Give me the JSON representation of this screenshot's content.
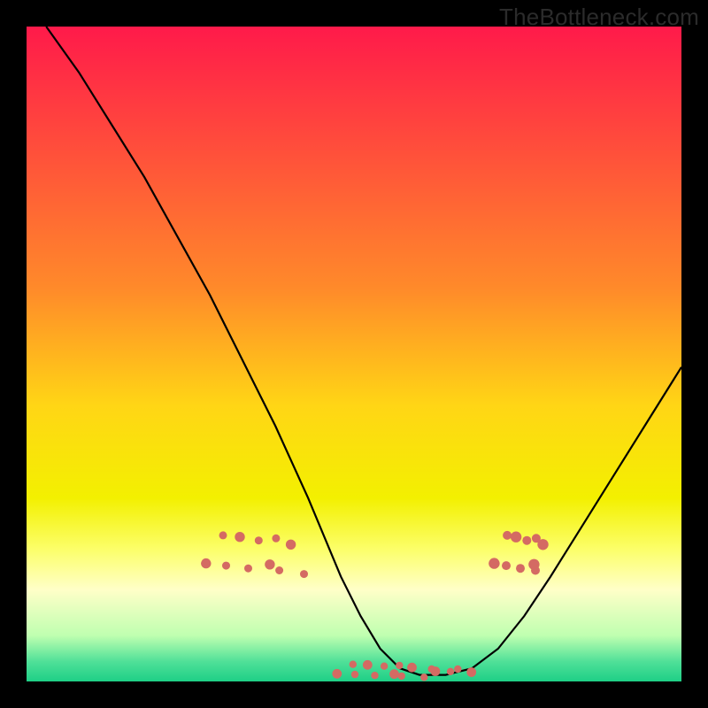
{
  "watermark": "TheBottleneck.com",
  "chart_data": {
    "type": "line",
    "title": "",
    "xlabel": "",
    "ylabel": "",
    "xlim": [
      0,
      100
    ],
    "ylim": [
      0,
      100
    ],
    "gradient_stops": [
      {
        "offset": 0,
        "color": "#ff1a4a"
      },
      {
        "offset": 40,
        "color": "#ff8a2a"
      },
      {
        "offset": 58,
        "color": "#ffd615"
      },
      {
        "offset": 72,
        "color": "#f3f000"
      },
      {
        "offset": 80,
        "color": "#fcff6c"
      },
      {
        "offset": 86,
        "color": "#ffffc8"
      },
      {
        "offset": 93,
        "color": "#bfffb0"
      },
      {
        "offset": 97,
        "color": "#4fe098"
      },
      {
        "offset": 100,
        "color": "#1ecf86"
      }
    ],
    "series": [
      {
        "name": "curve",
        "x": [
          3,
          8,
          13,
          18,
          23,
          28,
          33,
          38,
          43,
          48,
          51,
          54,
          57,
          60,
          64,
          68,
          72,
          76,
          80,
          85,
          90,
          95,
          100
        ],
        "y": [
          100,
          93,
          85,
          77,
          68,
          59,
          49,
          39,
          28,
          16,
          10,
          5,
          2,
          1,
          1,
          2,
          5,
          10,
          16,
          24,
          32,
          40,
          48
        ]
      }
    ],
    "highlight_band": {
      "ymin": 0,
      "ymax": 24
    },
    "dots": {
      "left_cluster": {
        "x_range": [
          28,
          43
        ],
        "y_range": [
          16,
          25
        ],
        "count": 11
      },
      "valley": {
        "x_range": [
          48,
          68
        ],
        "y_range": [
          0.5,
          3.5
        ],
        "count": 16
      },
      "right_cluster": {
        "x_range": [
          72,
          80
        ],
        "y_range": [
          16,
          25
        ],
        "count": 10
      }
    }
  }
}
